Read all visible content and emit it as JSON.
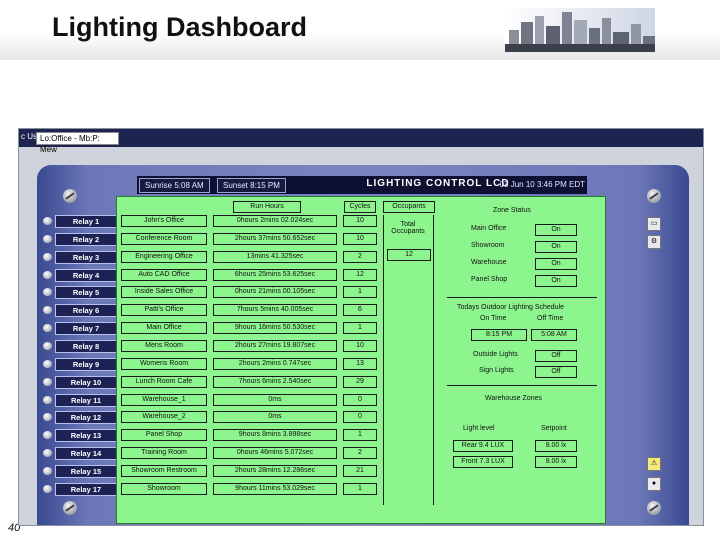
{
  "slide": {
    "title": "Lighting Dashboard",
    "page_number": "40"
  },
  "address_bar": {
    "label": "c Us",
    "value": "Lo:Office - Mb:P: Mew"
  },
  "topbar": {
    "sunrise": "Sunrise 5:08 AM",
    "sunset": "Sunset 8:15 PM",
    "title": "LIGHTING CONTROL LCD",
    "datetime": "03 Jun 10 3:46 PM EDT"
  },
  "columns": {
    "run_hours": "Run Hours",
    "cycles": "Cycles",
    "occupants": "Occupants"
  },
  "total_occupants": {
    "label": "Total Occupants",
    "value": "12"
  },
  "relays": [
    {
      "relay": "Relay 1",
      "name": "John's Office",
      "hours": "0hours 2mins 02.024sec",
      "cycles": "10"
    },
    {
      "relay": "Relay 2",
      "name": "Conference Room",
      "hours": "2hours 37mins 50.652sec",
      "cycles": "10"
    },
    {
      "relay": "Relay 3",
      "name": "Engineering Office",
      "hours": "13mins 41.325sec",
      "cycles": "2"
    },
    {
      "relay": "Relay 4",
      "name": "Auto CAD Office",
      "hours": "6hours 25mins 53.625sec",
      "cycles": "12"
    },
    {
      "relay": "Relay 5",
      "name": "Inside Sales Office",
      "hours": "0hours 21mins 00.105sec",
      "cycles": "1"
    },
    {
      "relay": "Relay 6",
      "name": "Patti's Office",
      "hours": "7hours 5mins 40.005sec",
      "cycles": "6"
    },
    {
      "relay": "Relay 7",
      "name": "Main Office",
      "hours": "9hours 16mins 50.530sec",
      "cycles": "1"
    },
    {
      "relay": "Relay 8",
      "name": "Mens Room",
      "hours": "2hours 27mins 19.807sec",
      "cycles": "10"
    },
    {
      "relay": "Relay 9",
      "name": "Womens Room",
      "hours": "2hours 2mins 0.747sec",
      "cycles": "13"
    },
    {
      "relay": "Relay 10",
      "name": "Lunch Room Cafe",
      "hours": "7hours 6mins 2.540sec",
      "cycles": "29"
    },
    {
      "relay": "Relay 11",
      "name": "Warehouse_1",
      "hours": "0ms",
      "cycles": "0"
    },
    {
      "relay": "Relay 12",
      "name": "Warehouse_2",
      "hours": "0ms",
      "cycles": "0"
    },
    {
      "relay": "Relay 13",
      "name": "Panel Shop",
      "hours": "9hours 8mins 3.898sec",
      "cycles": "1"
    },
    {
      "relay": "Relay 14",
      "name": "Training Room",
      "hours": "0hours 46mins 5.072sec",
      "cycles": "2"
    },
    {
      "relay": "Relay 15",
      "name": "Showroom Restroom",
      "hours": "2hours 28mins 12.286sec",
      "cycles": "21"
    },
    {
      "relay": "Relay 17",
      "name": "Showroom",
      "hours": "9hours 11mins 53.029sec",
      "cycles": "1"
    }
  ],
  "zone_status": {
    "title": "Zone Status",
    "zones": [
      {
        "name": "Main Office",
        "value": "On"
      },
      {
        "name": "Showroom",
        "value": "On"
      },
      {
        "name": "Warehouse",
        "value": "On"
      },
      {
        "name": "Panel Shop",
        "value": "On"
      }
    ]
  },
  "outdoor_schedule": {
    "title": "Todays Outdoor Lighting Schedule",
    "on_label": "On Time",
    "off_label": "Off Time",
    "on_time": "8:15 PM",
    "off_time": "5:08 AM",
    "outside_lights_label": "Outside Lights",
    "outside_lights_value": "Off",
    "sign_lights_label": "Sign Lights",
    "sign_lights_value": "Off"
  },
  "warehouse_zones": {
    "title": "Warehouse Zones",
    "light_level_label": "Light level",
    "setpoint_label": "Setpoint",
    "rows": [
      {
        "level": "Rear  9.4  LUX",
        "setpoint": "8.00 lx"
      },
      {
        "level": "Front  7.3  LUX",
        "setpoint": "8.00 lx"
      }
    ]
  },
  "colors": {
    "panel_green": "#8df58d",
    "frame_blue": "#7a84c2",
    "relay_button": "#1c2254"
  }
}
